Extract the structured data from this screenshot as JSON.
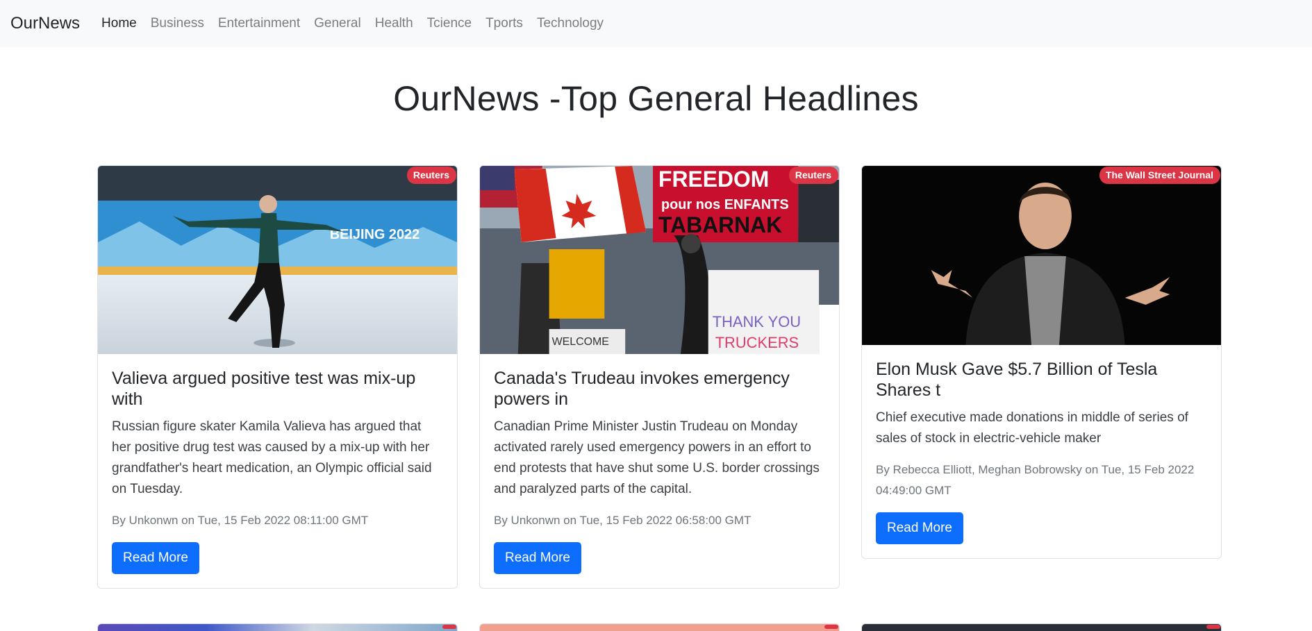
{
  "nav": {
    "brand": "OurNews",
    "items": [
      {
        "label": "Home",
        "active": true
      },
      {
        "label": "Business"
      },
      {
        "label": "Entertainment"
      },
      {
        "label": "General"
      },
      {
        "label": "Health"
      },
      {
        "label": "Tcience"
      },
      {
        "label": "Tports"
      },
      {
        "label": "Technology"
      }
    ]
  },
  "page_title": "OurNews -Top General Headlines",
  "articles": [
    {
      "source": "Reuters",
      "title": "Valieva argued positive test was mix-up with",
      "description": "Russian figure skater Kamila Valieva has argued that her positive drug test was caused by a mix-up with her grandfather's heart medication, an Olympic official said on Tuesday.",
      "meta": "By Unkonwn on Tue, 15 Feb 2022 08:11:00 GMT",
      "button": "Read More"
    },
    {
      "source": "Reuters",
      "title": "Canada's Trudeau invokes emergency powers in",
      "description": "Canadian Prime Minister Justin Trudeau on Monday activated rarely used emergency powers in an effort to end protests that have shut some U.S. border crossings and paralyzed parts of the capital.",
      "meta": "By Unkonwn on Tue, 15 Feb 2022 06:58:00 GMT",
      "button": "Read More"
    },
    {
      "source": "The Wall Street Journal",
      "title": "Elon Musk Gave $5.7 Billion of Tesla Shares t",
      "description": "Chief executive made donations in middle of series of sales of stock in electric-vehicle maker",
      "meta": "By Rebecca Elliott, Meghan Bobrowsky on Tue, 15 Feb 2022 04:49:00 GMT",
      "button": "Read More"
    }
  ],
  "colors": {
    "badge": "#dc3545",
    "button": "#0d6efd",
    "navbar_bg": "#f8f9fa"
  }
}
